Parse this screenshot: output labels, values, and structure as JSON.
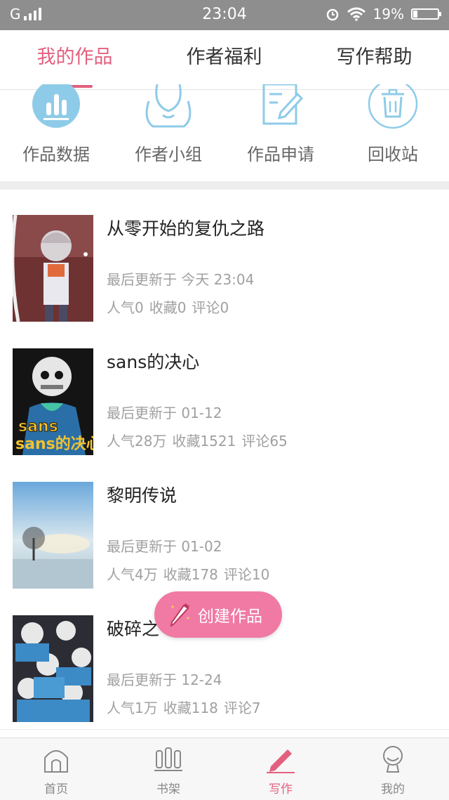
{
  "status_bar": {
    "network": "G",
    "time": "23:04",
    "battery": "19%",
    "battery_level": 0.19,
    "icons": [
      "signal-icon",
      "alarm-icon",
      "wifi-icon",
      "battery-icon"
    ]
  },
  "tabs": [
    {
      "label": "我的作品",
      "active": true
    },
    {
      "label": "作者福利",
      "active": false
    },
    {
      "label": "写作帮助",
      "active": false
    }
  ],
  "actions": [
    {
      "label": "作品数据",
      "icon": "chart-icon"
    },
    {
      "label": "作者小组",
      "icon": "group-icon"
    },
    {
      "label": "作品申请",
      "icon": "edit-icon"
    },
    {
      "label": "回收站",
      "icon": "trash-icon"
    }
  ],
  "works": [
    {
      "title": "从零开始的复仇之路",
      "updated": "最后更新于 今天 23:04",
      "popularity": "人气0",
      "favorites": "收藏0",
      "comments": "评论0",
      "cover": "anime-character-cover"
    },
    {
      "title": "sans的决心",
      "updated": "最后更新于 01-12",
      "popularity": "人气28万",
      "favorites": "收藏1521",
      "comments": "评论65",
      "cover": "sans-cover",
      "cover_text": "sans的决心"
    },
    {
      "title": "黎明传说",
      "updated": "最后更新于 01-02",
      "popularity": "人气4万",
      "favorites": "收藏178",
      "comments": "评论10",
      "cover": "winter-tree-cover"
    },
    {
      "title": "破碎之",
      "updated": "最后更新于 12-24",
      "popularity": "人气1万",
      "favorites": "收藏118",
      "comments": "评论7",
      "cover": "skeletons-cover"
    }
  ],
  "fab": {
    "label": "创建作品",
    "icon": "pencil-icon"
  },
  "bottom_nav": [
    {
      "label": "首页",
      "icon": "home-icon",
      "active": false
    },
    {
      "label": "书架",
      "icon": "bookshelf-icon",
      "active": false
    },
    {
      "label": "写作",
      "icon": "pen-icon",
      "active": true
    },
    {
      "label": "我的",
      "icon": "profile-icon",
      "active": false
    }
  ],
  "colors": {
    "accent": "#e2607e",
    "fab": "#f07aa4",
    "icon_blue": "#8ecbe8",
    "text_gray": "#a0a0a0"
  }
}
